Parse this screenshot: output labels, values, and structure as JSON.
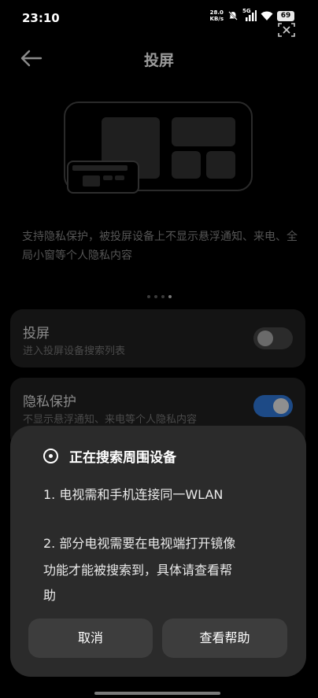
{
  "status_bar": {
    "time": "23:10",
    "net_speed_value": "28.0",
    "net_speed_unit": "KB/s",
    "network_type": "5G",
    "battery": "69"
  },
  "header": {
    "title": "投屏"
  },
  "description": "支持隐私保护，被投屏设备上不显示悬浮通知、来电、全局小窗等个人隐私内容",
  "pager": {
    "count": 4,
    "active_index": 3
  },
  "settings": [
    {
      "title": "投屏",
      "subtitle": "进入投屏设备搜索列表",
      "enabled": false
    },
    {
      "title": "隐私保护",
      "subtitle": "不显示悬浮通知、来电等个人隐私内容",
      "enabled": true
    }
  ],
  "dialog": {
    "title": "正在搜索周围设备",
    "line1": "1. 电视需和手机连接同一WLAN",
    "line2a": "2. 部分电视需要在电视端打开镜像",
    "line2b": "功能才能被搜索到，具体请查看帮",
    "line2c": "助",
    "cancel_label": "取消",
    "help_label": "查看帮助"
  },
  "colors": {
    "background": "#000000",
    "dialog_bg": "#2b2b2b",
    "toggle_on": "#1d4a86"
  }
}
